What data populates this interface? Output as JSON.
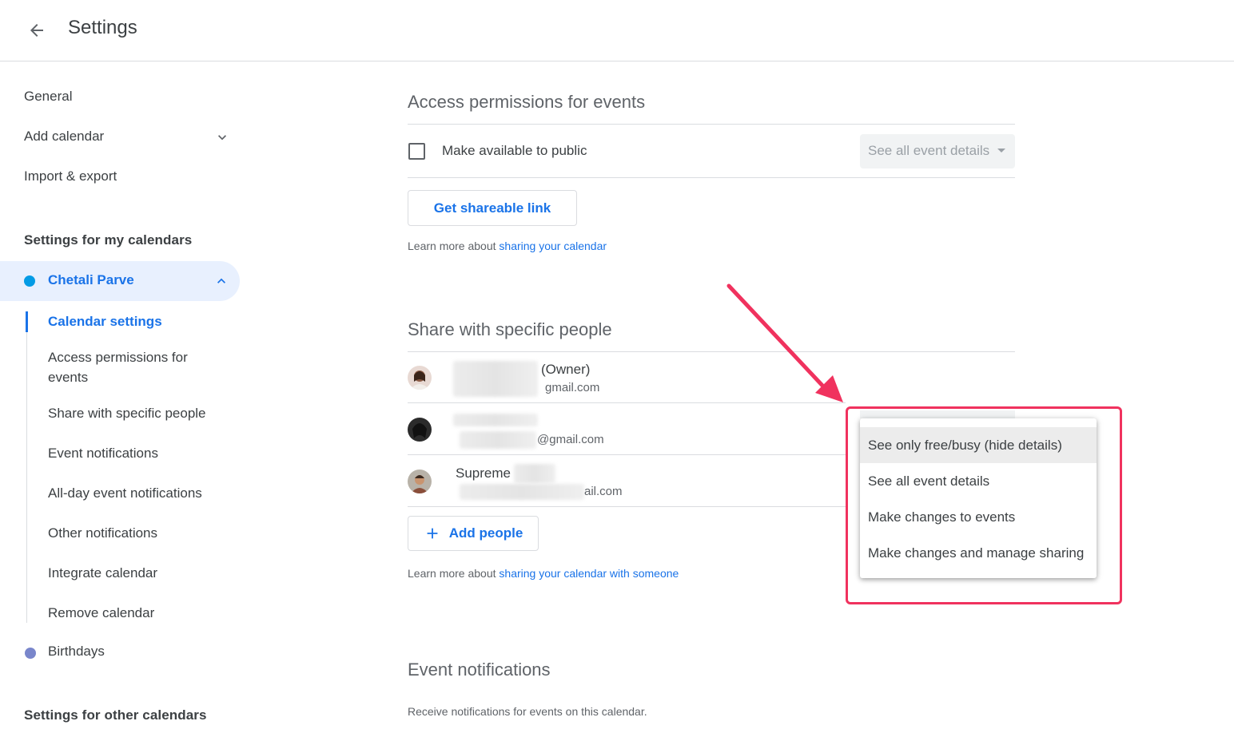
{
  "header": {
    "title": "Settings"
  },
  "sidebar": {
    "general": "General",
    "add_calendar": "Add calendar",
    "import_export": "Import & export",
    "my_calendars_heading": "Settings for my calendars",
    "active_calendar": {
      "name": "Chetali Parve",
      "color": "#039be5"
    },
    "subitems": [
      "Calendar settings",
      "Access permissions for events",
      "Share with specific people",
      "Event notifications",
      "All-day event notifications",
      "Other notifications",
      "Integrate calendar",
      "Remove calendar"
    ],
    "birthdays": {
      "name": "Birthdays",
      "color": "#7986cb"
    },
    "other_calendars_heading": "Settings for other calendars"
  },
  "access": {
    "title": "Access permissions for events",
    "public_label": "Make available to public",
    "public_select": "See all event details",
    "shareable_link": "Get shareable link",
    "help_prefix": "Learn more about ",
    "help_link": "sharing your calendar"
  },
  "share": {
    "title": "Share with specific people",
    "people": [
      {
        "name_suffix": "(Owner)",
        "email_suffix": "gmail.com"
      },
      {
        "email_suffix": "@gmail.com"
      },
      {
        "name": "Supreme",
        "email_suffix": "ail.com"
      }
    ],
    "add_people": "Add people",
    "help_prefix": "Learn more about ",
    "help_link": "sharing your calendar with someone"
  },
  "permission_menu": {
    "options": [
      "See only free/busy (hide details)",
      "See all event details",
      "Make changes to events",
      "Make changes and manage sharing"
    ],
    "highlight_color": "#f0325e"
  },
  "notifications": {
    "title": "Event notifications",
    "description": "Receive notifications for events on this calendar."
  }
}
